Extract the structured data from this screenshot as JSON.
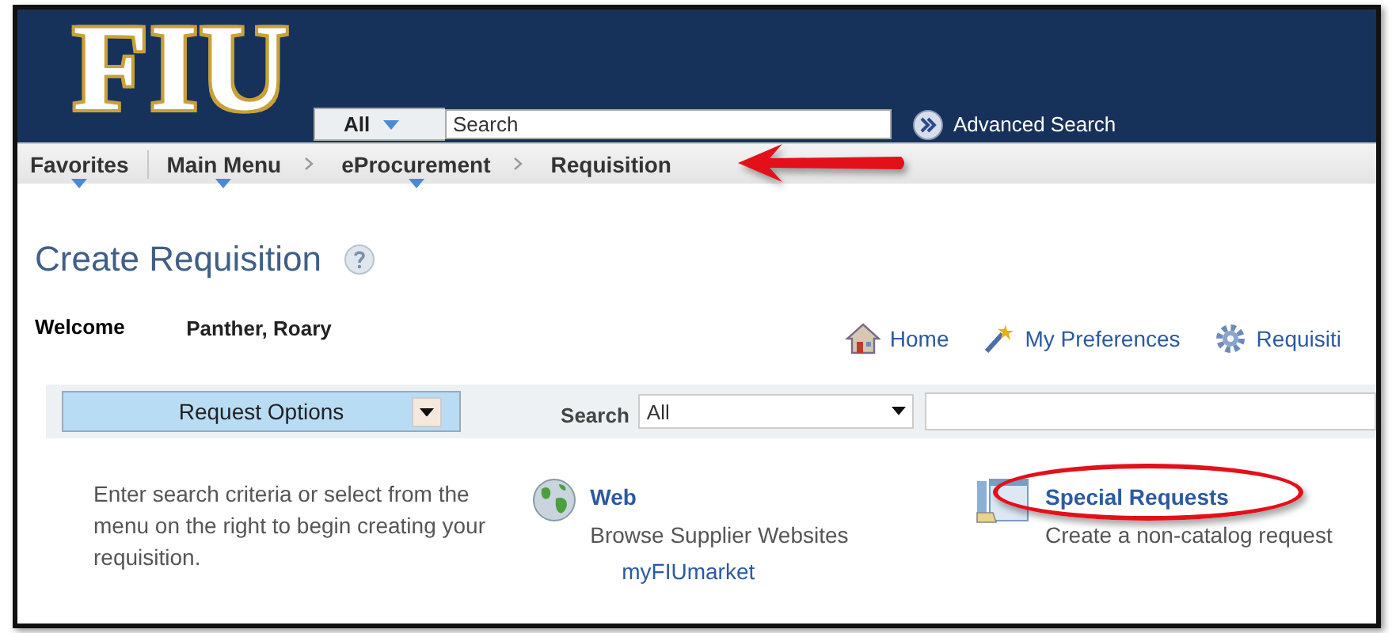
{
  "header": {
    "logo": "FIU",
    "search_scope": "All",
    "search_placeholder": "Search",
    "advanced_search": "Advanced Search"
  },
  "breadcrumb": [
    {
      "label": "Favorites",
      "menu": true
    },
    {
      "label": "Main Menu",
      "menu": true
    },
    {
      "label": "eProcurement",
      "menu": true
    },
    {
      "label": "Requisition",
      "menu": false
    }
  ],
  "annotation_arrow": true,
  "page_title": "Create Requisition",
  "welcome": {
    "label": "Welcome",
    "name": "Panther, Roary"
  },
  "links": [
    {
      "label": "Home",
      "kind": "home"
    },
    {
      "label": "My Preferences",
      "kind": "preferences"
    },
    {
      "label": "Requisiti",
      "kind": "settings"
    }
  ],
  "toolbar": {
    "button": "Request Options",
    "search_label": "Search",
    "search_scope": "All"
  },
  "instructions": "Enter search criteria or select from the menu on the right to begin creating your requisition.",
  "options": [
    {
      "title": "Web",
      "description": "Browse Supplier Websites",
      "link": "myFIUmarket",
      "kind": "web",
      "highlighted": false
    },
    {
      "title": "Special Requests",
      "description": "Create a non-catalog request",
      "kind": "special",
      "highlighted": true
    }
  ]
}
